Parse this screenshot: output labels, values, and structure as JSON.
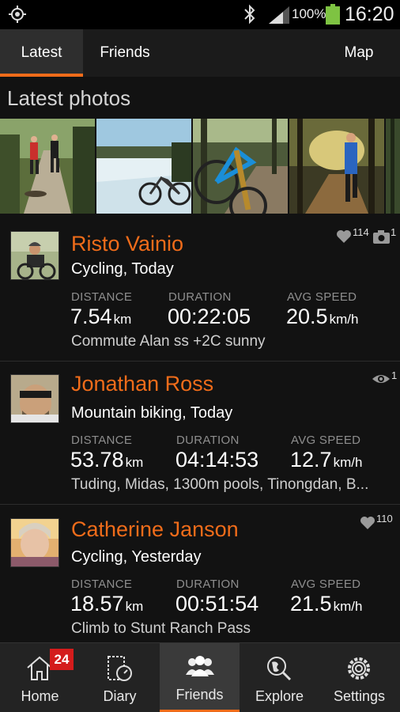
{
  "status_bar": {
    "battery_percent": "100%",
    "time": "16:20",
    "icons": [
      "gps-icon",
      "bluetooth-icon",
      "signal-icon",
      "battery-icon"
    ]
  },
  "tabs": [
    {
      "label": "Latest",
      "active": true
    },
    {
      "label": "Friends",
      "active": false
    },
    {
      "label": "Map",
      "active": false
    }
  ],
  "latest_photos": {
    "title": "Latest photos",
    "photos": [
      "runners-on-trail",
      "mountain-bike-by-lake",
      "bike-on-forest-trail",
      "runner-in-forest",
      "forest-edge"
    ]
  },
  "feed": [
    {
      "name": "Risto Vainio",
      "activity": "Cycling, Today",
      "distance_label": "DISTANCE",
      "distance": "7.54",
      "distance_unit": "km",
      "duration_label": "DURATION",
      "duration": "00:22:05",
      "speed_label": "AVG SPEED",
      "speed": "20.5",
      "speed_unit": "km/h",
      "description": "Commute Alan ss +2C sunny",
      "likes": "114",
      "photos": "1"
    },
    {
      "name": "Jonathan Ross",
      "activity": "Mountain biking, Today",
      "distance_label": "DISTANCE",
      "distance": "53.78",
      "distance_unit": "km",
      "duration_label": "DURATION",
      "duration": "04:14:53",
      "speed_label": "AVG SPEED",
      "speed": "12.7",
      "speed_unit": "km/h",
      "description": "Tuding, Midas, 1300m pools, Tinongdan, B...",
      "views": "1"
    },
    {
      "name": "Catherine Janson",
      "activity": "Cycling, Yesterday",
      "distance_label": "DISTANCE",
      "distance": "18.57",
      "distance_unit": "km",
      "duration_label": "DURATION",
      "duration": "00:51:54",
      "speed_label": "AVG SPEED",
      "speed": "21.5",
      "speed_unit": "km/h",
      "description": "Climb to Stunt Ranch Pass",
      "likes": "110"
    }
  ],
  "bottom_nav": [
    {
      "label": "Home",
      "icon": "home-icon",
      "badge": "24"
    },
    {
      "label": "Diary",
      "icon": "diary-icon"
    },
    {
      "label": "Friends",
      "icon": "friends-icon",
      "active": true
    },
    {
      "label": "Explore",
      "icon": "explore-icon"
    },
    {
      "label": "Settings",
      "icon": "settings-icon"
    }
  ],
  "colors": {
    "accent": "#f06c1a",
    "background": "#121212",
    "badge": "#d41c1c"
  }
}
